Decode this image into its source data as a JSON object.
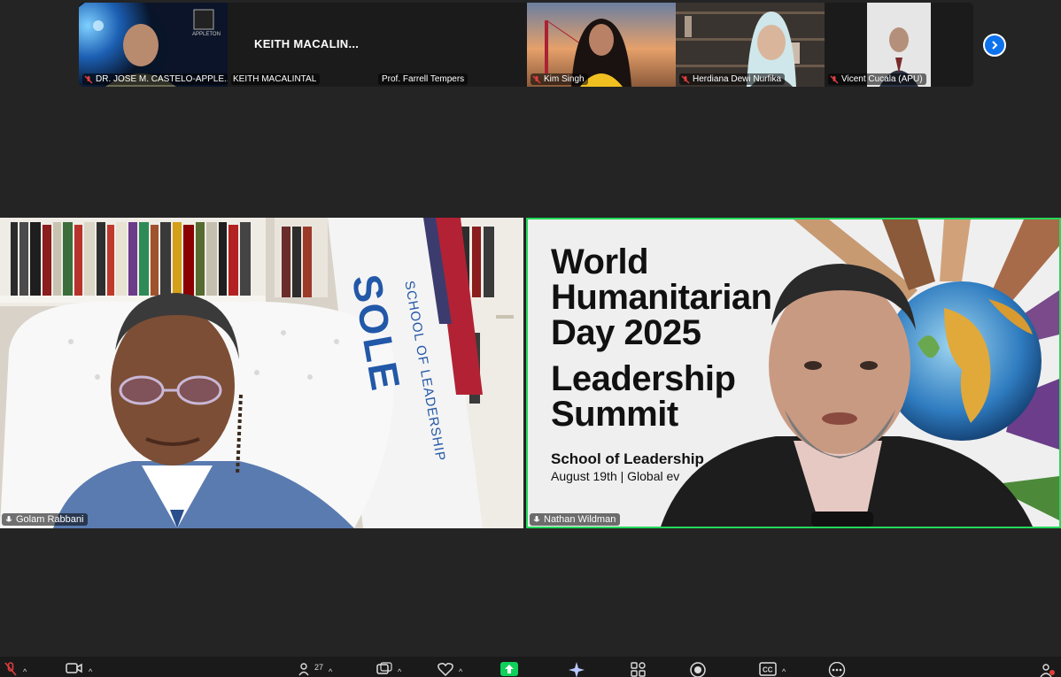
{
  "strip": {
    "tiles": [
      {
        "name": "DR. JOSE M. CASTELO-APPLE..."
      },
      {
        "name": "KEITH MACALINTAL",
        "display": "KEITH MACALIN..."
      },
      {
        "name": "Prof. Farrell Tempers"
      },
      {
        "name": "Kim Singh"
      },
      {
        "name": "Herdiana Dewi Nurfika"
      },
      {
        "name": "Vicent Cucala (APU)"
      }
    ],
    "logo_text": "APPLETON"
  },
  "main": {
    "left": {
      "name": "Golam Rabbani",
      "flag_text": "SOLE",
      "flag_sub": "SCHOOL OF LEADERSHIP"
    },
    "right": {
      "name": "Nathan Wildman",
      "bg_line1": "World",
      "bg_line2": "Humanitarian",
      "bg_line3": "Day 2025",
      "bg_line4": "Leadership",
      "bg_line5": "Summit",
      "bg_line6": "School of Leadership",
      "bg_line7": "August 19th | Global ev"
    }
  },
  "toolbar": {
    "participants_count": "27"
  },
  "colors": {
    "active_speaker_border": "#23d959",
    "accent": "#0e72ed",
    "share_green": "#0fd15c"
  }
}
